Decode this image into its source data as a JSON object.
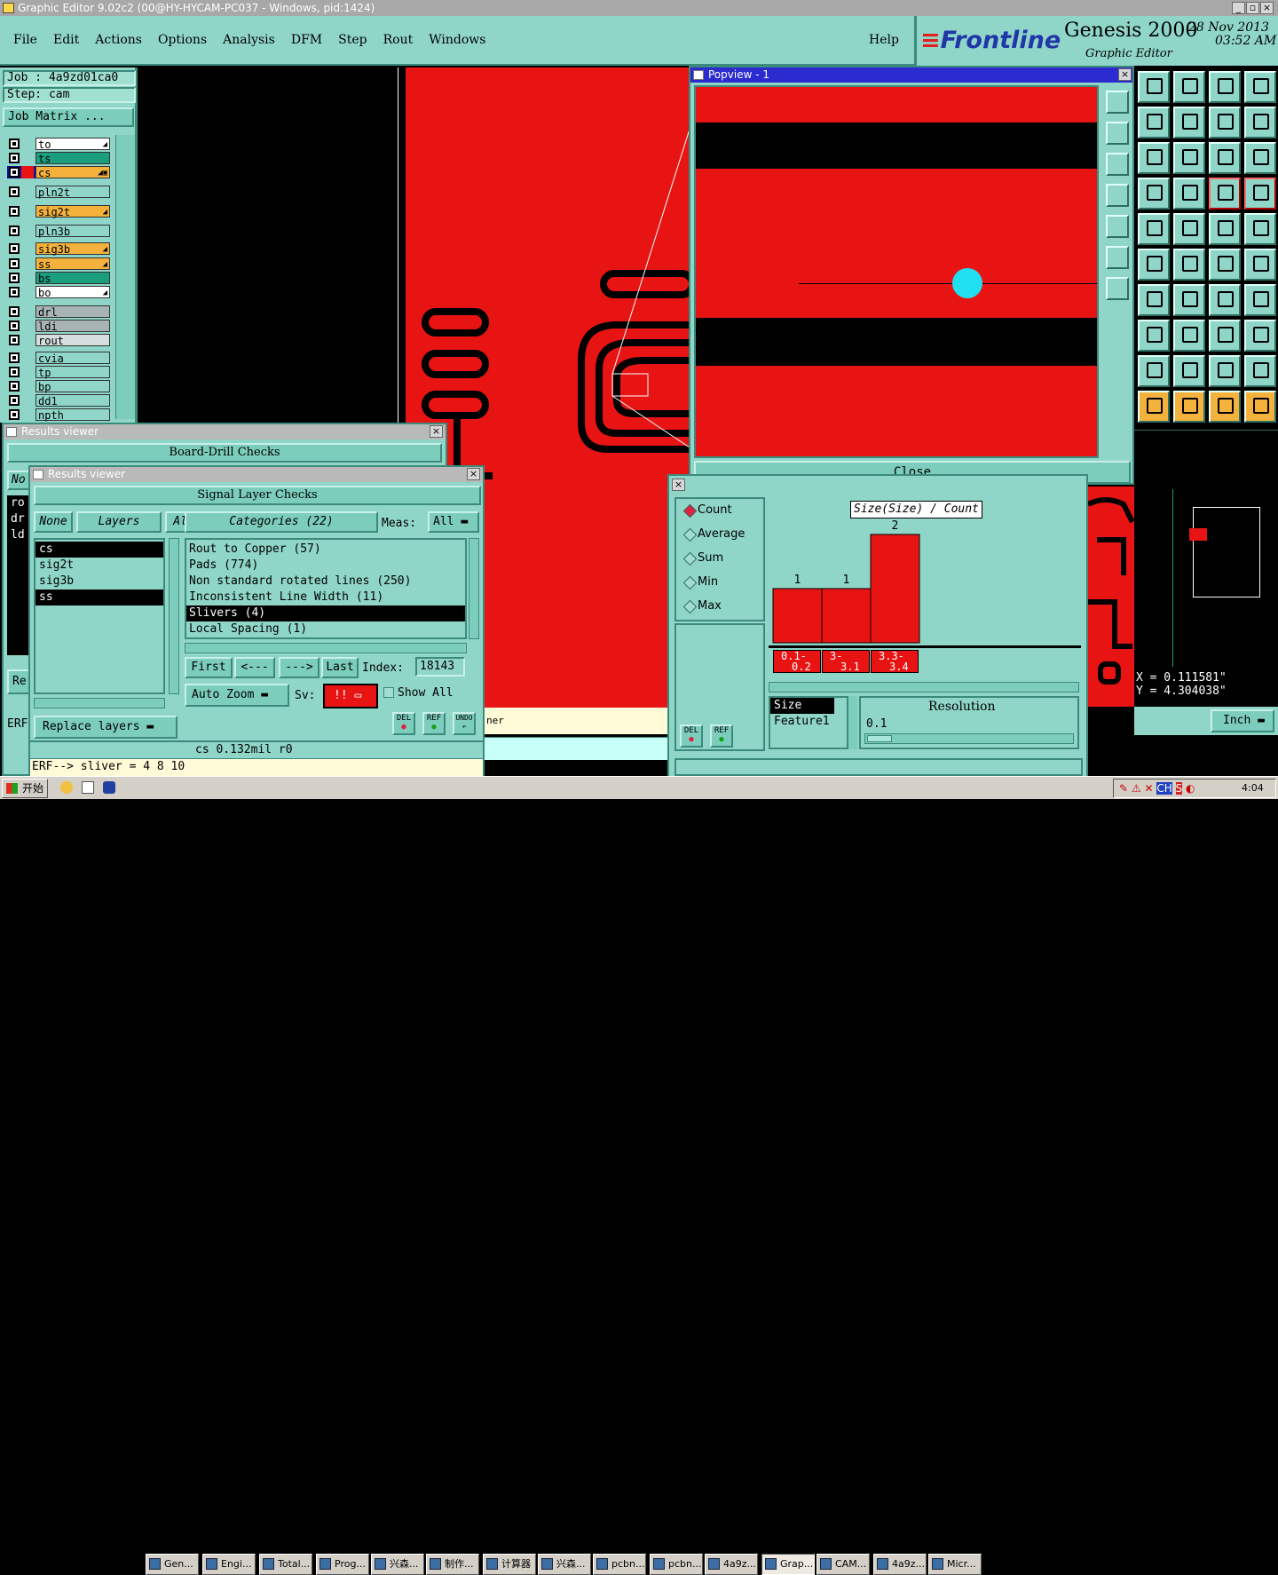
{
  "window": {
    "title": "Graphic Editor 9.02c2 (00@HY-HYCAM-PC037 - Windows, pid:1424)"
  },
  "menu": [
    "File",
    "Edit",
    "Actions",
    "Options",
    "Analysis",
    "DFM",
    "Step",
    "Rout",
    "Windows"
  ],
  "help_label": "Help",
  "brand": {
    "logo": "Frontline",
    "product": "Genesis 2000",
    "subtitle": "Graphic Editor",
    "date": "28 Nov 2013",
    "time": "03:52 AM"
  },
  "job": {
    "job_label": "Job : 4a9zd01ca0",
    "step_label": "Step: cam",
    "matrix_button": "Job Matrix ..."
  },
  "layers": [
    {
      "name": "to",
      "color": "#ffffff",
      "mark": "◢"
    },
    {
      "name": "ts",
      "color": "#1a9e7e",
      "mark": ""
    },
    {
      "name": "cs",
      "color": "#f4b23c",
      "mark": "◢▣"
    },
    {
      "name": "pln2t",
      "color": "#8fd6c8",
      "mark": ""
    },
    {
      "name": "sig2t",
      "color": "#f4b23c",
      "mark": "◢"
    },
    {
      "name": "pln3b",
      "color": "#8fd6c8",
      "mark": ""
    },
    {
      "name": "sig3b",
      "color": "#f4b23c",
      "mark": "◢"
    },
    {
      "name": "ss",
      "color": "#f4b23c",
      "mark": "◢"
    },
    {
      "name": "bs",
      "color": "#1a9e7e",
      "mark": ""
    },
    {
      "name": "bo",
      "color": "#ffffff",
      "mark": "◢"
    },
    {
      "name": "drl",
      "color": "#a8b4b4",
      "mark": ""
    },
    {
      "name": "ldi",
      "color": "#a8b4b4",
      "mark": ""
    },
    {
      "name": "rout",
      "color": "#d6dede",
      "mark": ""
    },
    {
      "name": "cvia",
      "color": "#8fd6c8",
      "mark": ""
    },
    {
      "name": "tp",
      "color": "#8fd6c8",
      "mark": ""
    },
    {
      "name": "bp",
      "color": "#8fd6c8",
      "mark": ""
    },
    {
      "name": "dd1",
      "color": "#8fd6c8",
      "mark": ""
    },
    {
      "name": "npth",
      "color": "#8fd6c8",
      "mark": ""
    }
  ],
  "results1": {
    "title": "Results viewer",
    "header": "Board-Drill Checks",
    "stub_none": "No",
    "stub_rows": [
      "ro",
      "dr",
      "ld"
    ],
    "stub_r": "Re",
    "stub_erf": "ERF"
  },
  "results2": {
    "title": "Results viewer",
    "header": "Signal Layer Checks",
    "none_label": "None",
    "layers_label": "Layers",
    "all_label": "All",
    "layer_list": [
      "cs",
      "sig2t",
      "sig3b",
      "ss"
    ],
    "categories_label": "Categories (22)",
    "meas_label": "Meas:",
    "meas_value": "All",
    "categories": [
      "Rout to Copper (57)",
      "Pads (774)",
      "Non standard rotated lines (250)",
      "Inconsistent Line Width (11)",
      "Slivers (4)",
      "Local Spacing (1)"
    ],
    "nav": {
      "first": "First",
      "prev": "<---",
      "next": "--->",
      "last": "Last",
      "index_label": "Index:",
      "index_value": "18143"
    },
    "auto_zoom": "Auto Zoom",
    "sv_label": "Sv:",
    "sv_value": "!!",
    "show_all": "Show All",
    "replace_layers": "Replace layers",
    "del": "DEL",
    "ref": "REF",
    "undo": "UNDO",
    "status_line": "cs 0.132mil  r0",
    "erf_line": "ERF--> sliver = 4 8 10"
  },
  "popview": {
    "title": "Popview - 1",
    "close_label": "Close"
  },
  "histogram": {
    "radios": [
      "Count",
      "Average",
      "Sum",
      "Min",
      "Max"
    ],
    "selected": "Count",
    "chart_title": "Size(Size) / Count",
    "size_label": "Size",
    "feature_label": "Feature1",
    "resolution_label": "Resolution",
    "resolution_value": "0.1",
    "del": "DEL",
    "ref": "REF",
    "bar_labels": [
      [
        "0.1-",
        "0.2"
      ],
      [
        "3-",
        "3.1"
      ],
      [
        "3.3-",
        "3.4"
      ]
    ]
  },
  "chart_data": {
    "type": "bar",
    "title": "Size(Size) / Count",
    "categories": [
      "0.1-0.2",
      "3-3.1",
      "3.3-3.4"
    ],
    "values": [
      1,
      1,
      2
    ],
    "bar_color": "#e81414"
  },
  "editor": {
    "note": "ner"
  },
  "coords": {
    "x": "X = 0.111581\"",
    "y": "Y = 4.304038\"",
    "unit": "Inch"
  },
  "taskbar": {
    "start": "开始",
    "items": [
      "Gen...",
      "Engi...",
      "Total...",
      "Prog...",
      "兴森...",
      "制作...",
      "计算器",
      "兴森...",
      "pcbn...",
      "pcbn...",
      "4a9z...",
      "Grap...",
      "CAM...",
      "4a9z...",
      "Micr..."
    ],
    "tray_time": "4:04"
  }
}
